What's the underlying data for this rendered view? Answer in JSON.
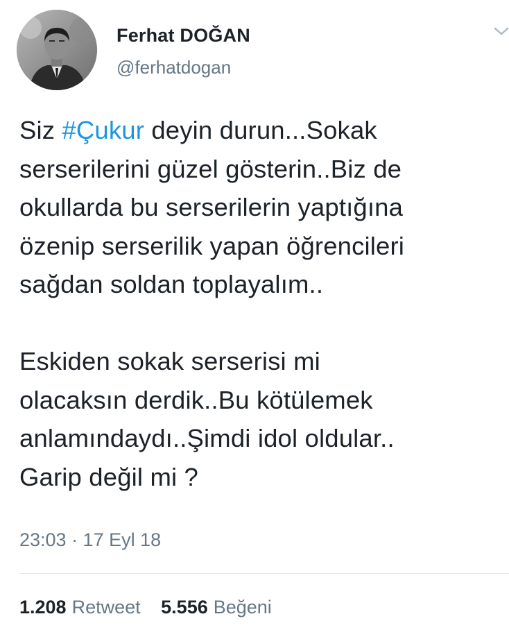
{
  "tweet": {
    "author": {
      "display_name": "Ferhat DOĞAN",
      "handle": "@ferhatdogan",
      "avatar_icon": "profile-photo"
    },
    "menu_icon": "chevron-down-icon",
    "text": {
      "line1_prefix": "Siz ",
      "hashtag": "#Çukur",
      "line1_suffix": " deyin durun...Sokak",
      "line2": "serserilerini güzel gösterin..Biz de",
      "line3": "okullarda bu serserilerin yaptığına",
      "line4": "özenip serserilik yapan öğrencileri",
      "line5": "sağdan soldan toplayalım..",
      "line6": "Eskiden sokak serserisi mi",
      "line7": "olacaksın derdik..Bu kötülemek",
      "line8": "anlamındaydı..Şimdi idol oldular..",
      "line9": "Garip değil mi ?"
    },
    "timestamp": "23:03 · 17 Eyl 18",
    "stats": {
      "retweet_count": "1.208",
      "retweet_label": "Retweet",
      "like_count": "5.556",
      "like_label": "Beğeni"
    },
    "colors": {
      "text": "#1c2228",
      "secondary": "#657786",
      "hashtag": "#1b95e0",
      "divider": "#e1e8ed"
    }
  }
}
